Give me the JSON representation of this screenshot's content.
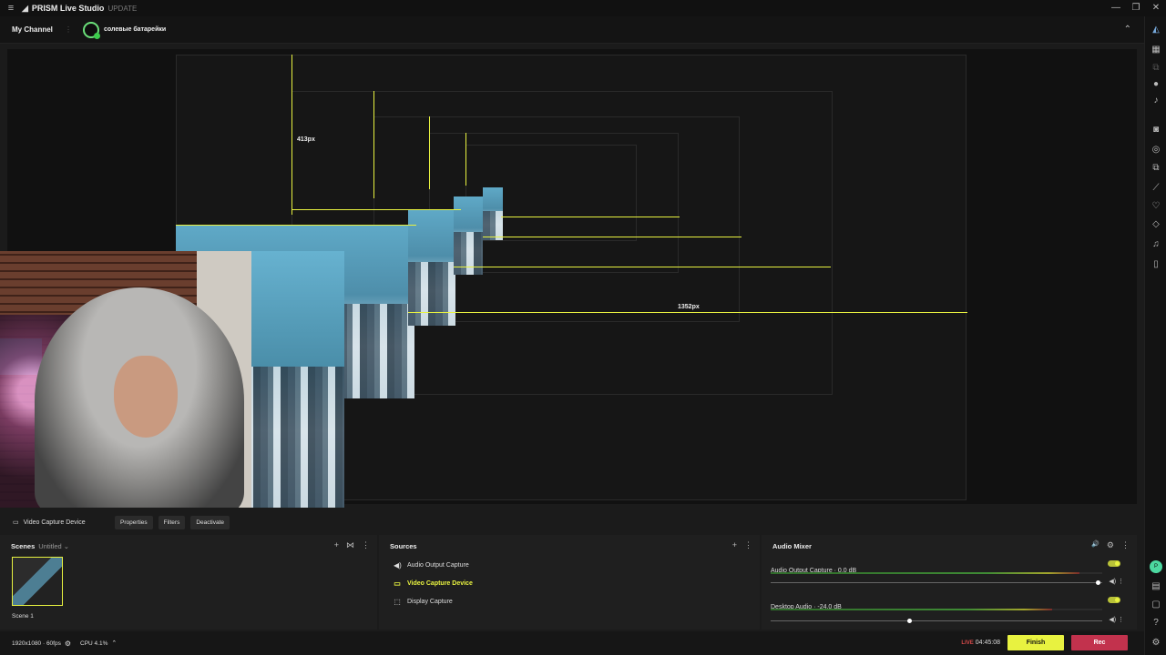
{
  "titlebar": {
    "logo": "◢",
    "app_name": "PRISM Live Studio",
    "update": "UPDATE",
    "menu_icon": "hamburger-icon",
    "win_min": "—",
    "win_max": "❐",
    "win_close": "✕"
  },
  "channelbar": {
    "my_channel": "My Channel",
    "dots": "⋮",
    "channel_name": "солевые батарейки",
    "collapse": "⌃"
  },
  "preview": {
    "label_413": "413px",
    "label_1352": "1352px"
  },
  "source_toolbar": {
    "device": "Video Capture Device",
    "properties": "Properties",
    "filters": "Filters",
    "deactivate": "Deactivate"
  },
  "scenes": {
    "title": "Scenes",
    "collection": "Untitled ⌄",
    "add": "+",
    "transition": "⋈",
    "more": "⋮",
    "scene1": "Scene 1"
  },
  "sources": {
    "title": "Sources",
    "add": "+",
    "more": "⋮",
    "items": [
      {
        "label": "Audio Output Capture",
        "icon": "◀)"
      },
      {
        "label": "Video Capture Device",
        "icon": "▭"
      },
      {
        "label": "Display Capture",
        "icon": "⬚"
      }
    ]
  },
  "mixer": {
    "title": "Audio Mixer",
    "speaker": "🔊",
    "gear": "⚙",
    "more": "⋮",
    "channels": [
      {
        "name": "Audio Output Capture · 0.0 dB",
        "level": 0.93,
        "volume": 0.99
      },
      {
        "name": "Desktop Audio · -24.0 dB",
        "level": 0.85,
        "volume": 0.42
      }
    ]
  },
  "status": {
    "resolution": "1920x1080 · 60fps",
    "cpu": "CPU 4.1%",
    "live": "LIVE",
    "timer": "04:45:08",
    "finish": "Finish",
    "rec": "Rec"
  },
  "colors": {
    "accent": "#e8f240",
    "rec": "#c2324d",
    "live": "#d84b4b"
  }
}
